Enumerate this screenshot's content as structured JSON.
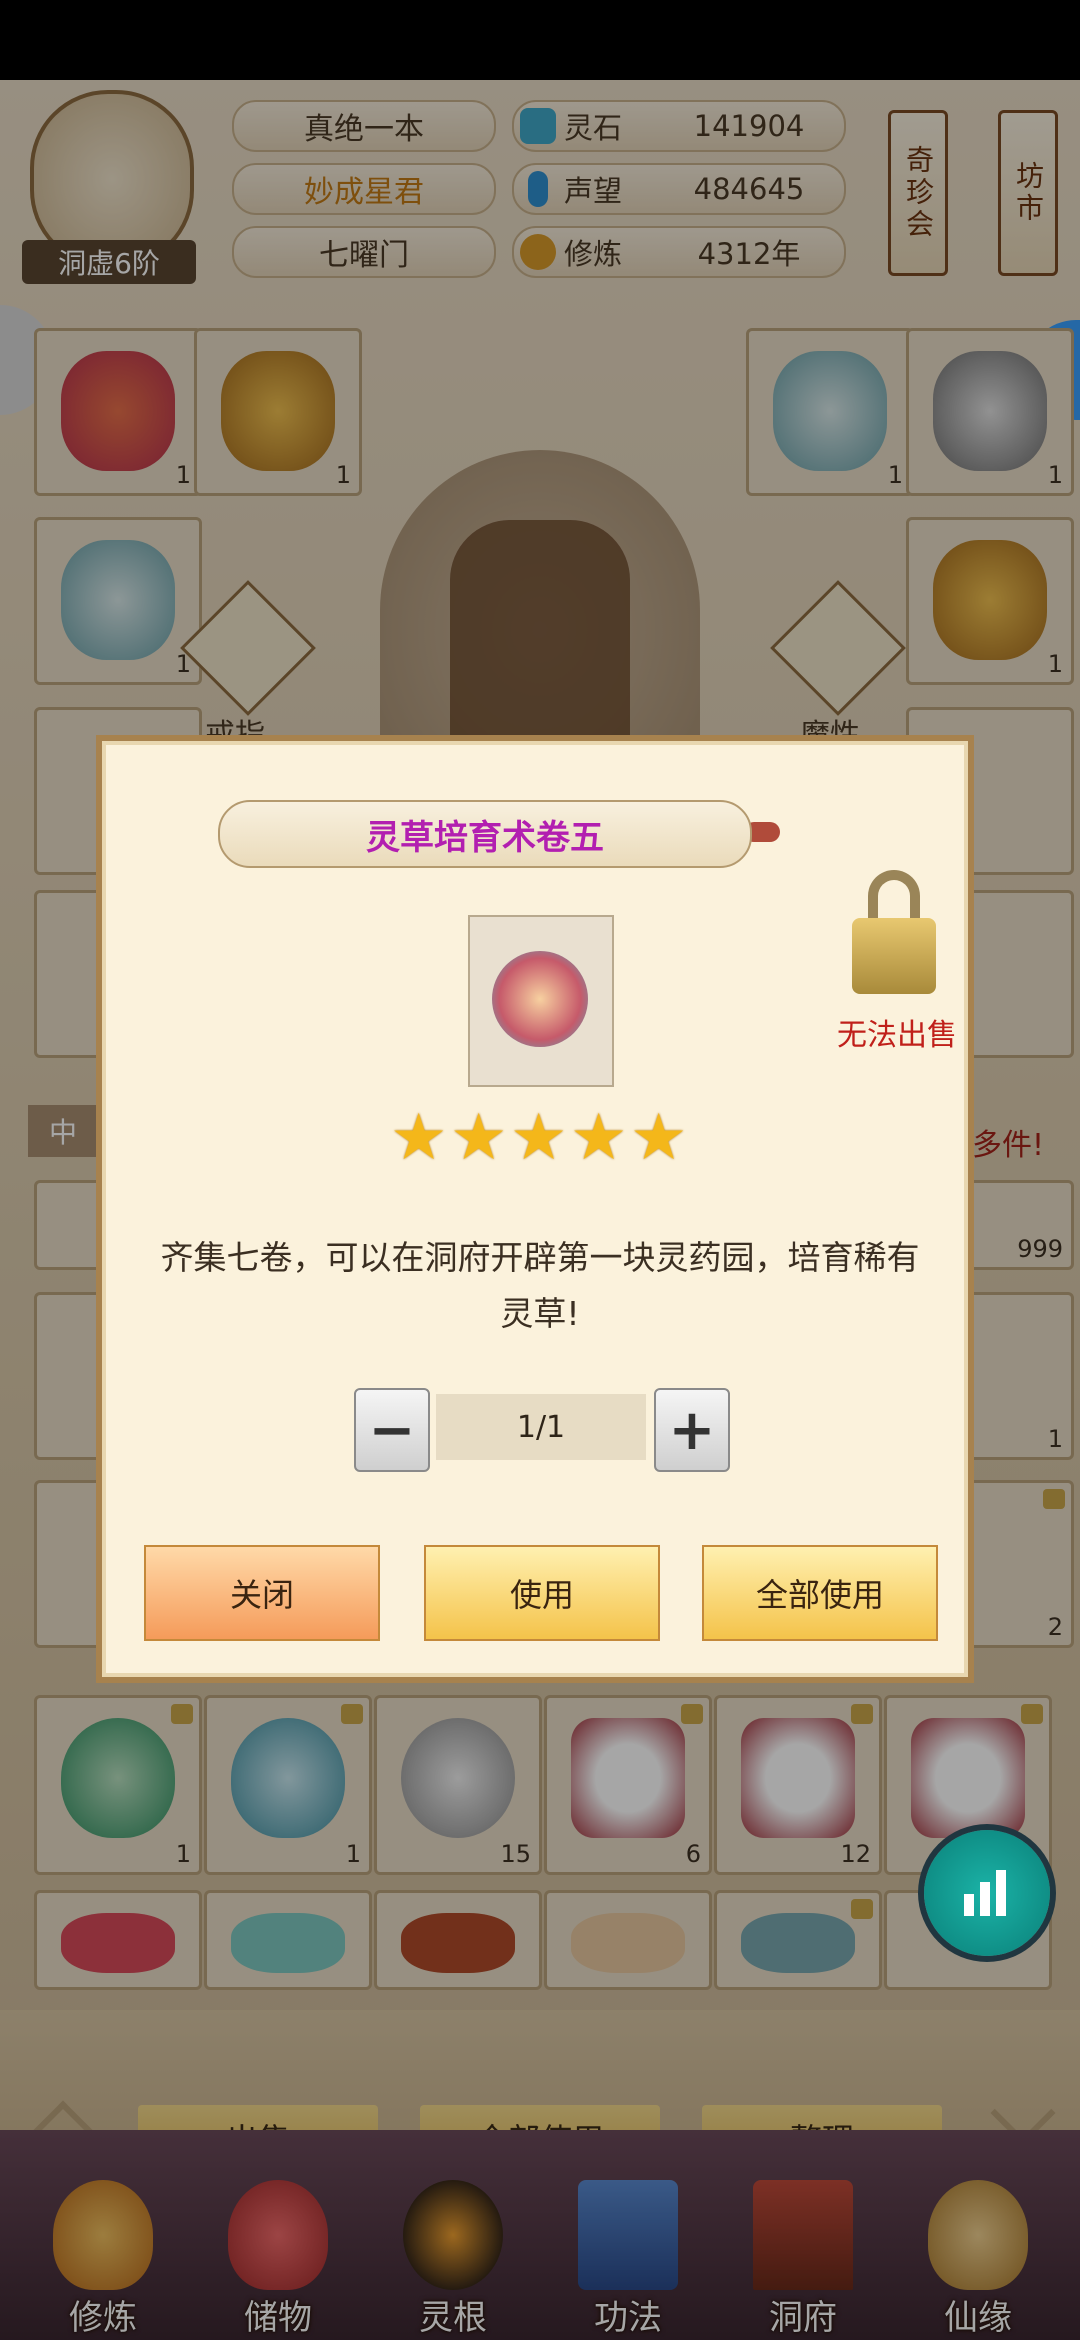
{
  "header": {
    "realm_badge": "洞虚6阶",
    "player_name": "真绝一本",
    "title": "妙成星君",
    "sect": "七曜门",
    "resources": [
      {
        "name": "灵石",
        "value": "141904",
        "icon": "spirit-stone-icon",
        "color": "#3fa8c8"
      },
      {
        "name": "声望",
        "value": "484645",
        "icon": "reputation-icon",
        "color": "#2f8fd0"
      },
      {
        "name": "修炼",
        "value": "4312年",
        "icon": "cultivation-icon",
        "color": "#d89a2a"
      }
    ],
    "banner_left": "奇珍会",
    "banner_right": "坊市"
  },
  "equip_labels": {
    "left": "戒指",
    "right": "魔性"
  },
  "notice_left": "中",
  "notice_right": "多件!",
  "right_count": "999",
  "grid_counts": {
    "r1": [
      "1",
      "1",
      "1",
      "1"
    ],
    "r2": [
      "1",
      "1"
    ],
    "bottom": [
      "1",
      "1",
      "15",
      "6",
      "12",
      ""
    ],
    "side_right": "1",
    "side_right2": "2"
  },
  "bottom_buttons": {
    "sell": "出售",
    "use_all": "全部使用",
    "sort": "整理"
  },
  "nav": [
    {
      "label": "修炼",
      "icon": "cultivate-nav-icon"
    },
    {
      "label": "储物",
      "icon": "storage-bag-nav-icon"
    },
    {
      "label": "灵根",
      "icon": "spirit-root-nav-icon"
    },
    {
      "label": "功法",
      "icon": "technique-book-nav-icon"
    },
    {
      "label": "洞府",
      "icon": "cave-mansion-nav-icon"
    },
    {
      "label": "仙缘",
      "icon": "immortal-fate-nav-icon"
    }
  ],
  "dialog": {
    "title": "灵草培育术卷五",
    "stars": 5,
    "description": "齐集七卷，可以在洞府开辟第一块灵药园，培育稀有灵草!",
    "quantity": "1/1",
    "no_sell": "无法出售",
    "close": "关闭",
    "use": "使用",
    "use_all": "全部使用"
  },
  "colors": {
    "dialog_title": "#b21fb0",
    "no_sell": "#c0201a",
    "star": "#f4b71a"
  }
}
